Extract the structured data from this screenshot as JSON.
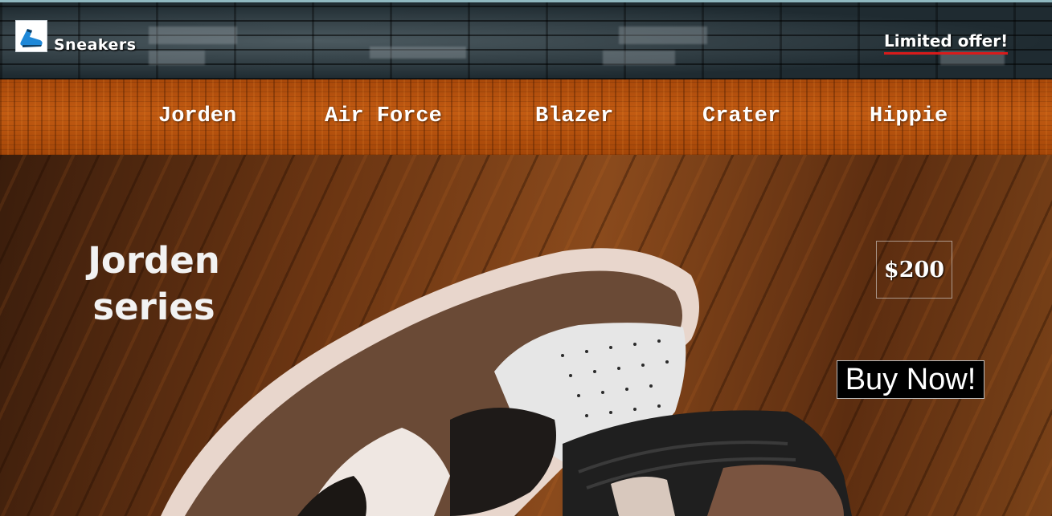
{
  "header": {
    "brand": "Sneakers",
    "offer_link": "Limited offer!",
    "logo_icon": "sneaker-logo-icon"
  },
  "nav": {
    "items": [
      {
        "label": "Jorden"
      },
      {
        "label": "Air Force"
      },
      {
        "label": "Blazer"
      },
      {
        "label": "Crater"
      },
      {
        "label": "Hippie"
      }
    ]
  },
  "hero": {
    "title": "Jorden series",
    "price": "$200",
    "buy_label": "Buy Now!"
  },
  "colors": {
    "offer_underline": "#d81b1b",
    "nav_wood": "#b85410",
    "buy_button_bg": "#000000"
  }
}
